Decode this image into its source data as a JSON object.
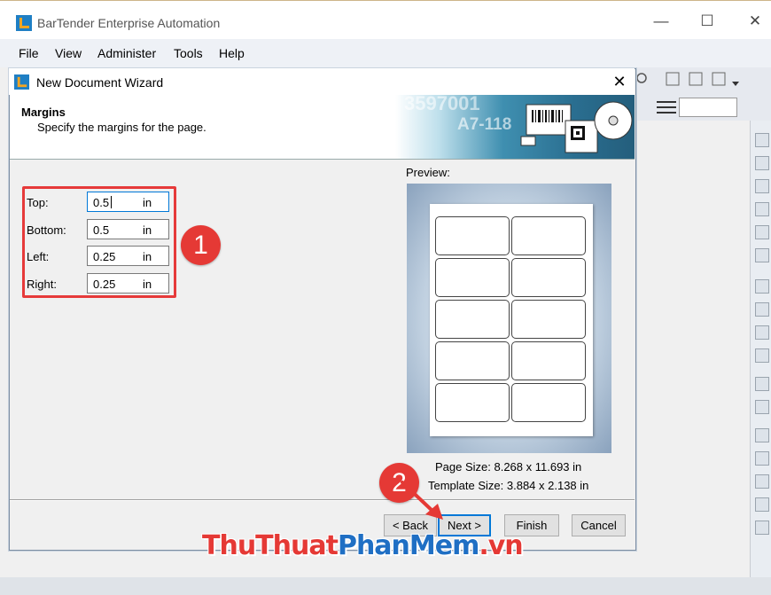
{
  "app": {
    "title": "BarTender Enterprise Automation",
    "minimize": "—",
    "maximize": "☐",
    "close": "✕"
  },
  "menu": [
    "File",
    "View",
    "Administer",
    "Tools",
    "Help"
  ],
  "dialog": {
    "title": "New Document Wizard",
    "close": "✕",
    "header_title": "Margins",
    "header_subtitle": "Specify the margins for the page.",
    "banner_text_1": "3597001",
    "banner_text_2": "A7-118"
  },
  "fields": [
    {
      "label": "Top:",
      "value": "0.5",
      "unit": "in"
    },
    {
      "label": "Bottom:",
      "value": "0.5",
      "unit": "in"
    },
    {
      "label": "Left:",
      "value": "0.25",
      "unit": "in"
    },
    {
      "label": "Right:",
      "value": "0.25",
      "unit": "in"
    }
  ],
  "preview": {
    "label": "Preview:",
    "page_size": "Page Size:  8.268 x 11.693 in",
    "template_size": "Template Size:  3.884 x 2.138 in",
    "rows": 5,
    "cols": 2
  },
  "buttons": {
    "back": "< Back",
    "next": "Next >",
    "finish": "Finish",
    "cancel": "Cancel"
  },
  "annotations": {
    "badge1": "1",
    "badge2": "2"
  },
  "watermark": {
    "part1": "ThuThuat",
    "part2": "PhanMem",
    "part3": ".vn"
  },
  "colors": {
    "accent": "#0078d7",
    "annotation_red": "#e53935",
    "watermark_blue": "#1f6fc4"
  }
}
